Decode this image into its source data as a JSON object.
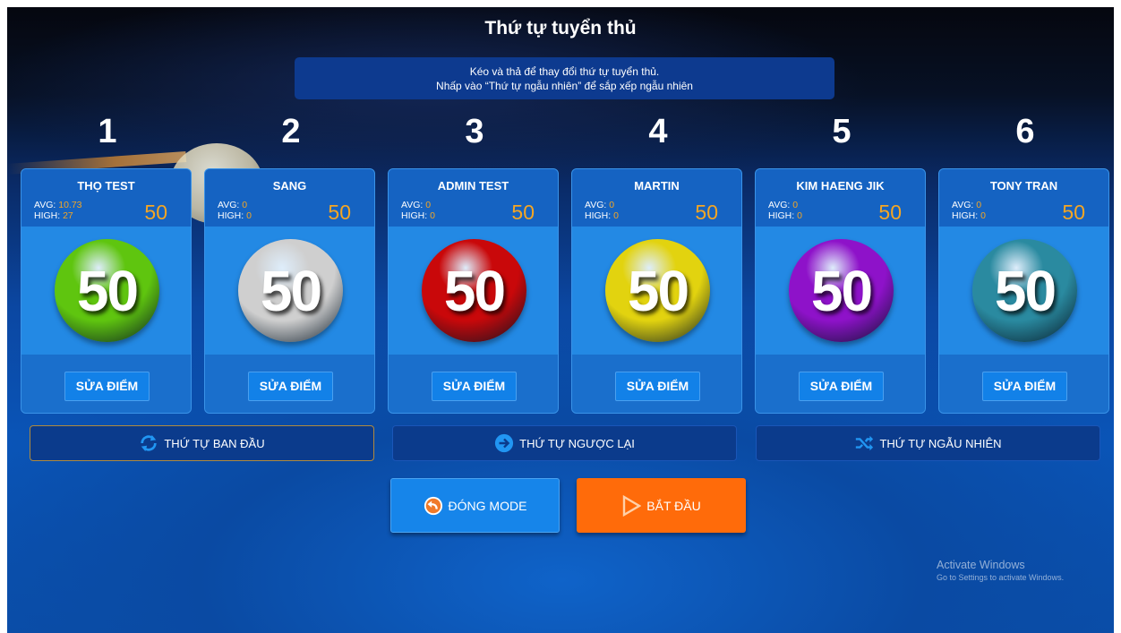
{
  "title": "Thứ tự tuyển thủ",
  "info": {
    "line1": "Kéo và thả để thay đổi thứ tự tuyển thủ.",
    "line2": "Nhấp vào “Thứ tự ngẫu nhiên” để sắp xếp ngẫu nhiên"
  },
  "players": [
    {
      "position": "1",
      "name": "THỌ TEST",
      "avg_label": "AVG:",
      "avg": "10.73",
      "high_label": "HIGH:",
      "high": "27",
      "score": "50",
      "ball_number": "50",
      "ball_color": "#5fc50f",
      "edit_label": "SỬA ĐIỂM"
    },
    {
      "position": "2",
      "name": "SANG",
      "avg_label": "AVG:",
      "avg": "0",
      "high_label": "HIGH:",
      "high": "0",
      "score": "50",
      "ball_number": "50",
      "ball_color": "#cfcfcf",
      "edit_label": "SỬA ĐIỂM"
    },
    {
      "position": "3",
      "name": "ADMIN TEST",
      "avg_label": "AVG:",
      "avg": "0",
      "high_label": "HIGH:",
      "high": "0",
      "score": "50",
      "ball_number": "50",
      "ball_color": "#c9080a",
      "edit_label": "SỬA ĐIỂM"
    },
    {
      "position": "4",
      "name": "MARTIN",
      "avg_label": "AVG:",
      "avg": "0",
      "high_label": "HIGH:",
      "high": "0",
      "score": "50",
      "ball_number": "50",
      "ball_color": "#e2d30f",
      "edit_label": "SỬA ĐIỂM"
    },
    {
      "position": "5",
      "name": "KIM HAENG JIK",
      "avg_label": "AVG:",
      "avg": "0",
      "high_label": "HIGH:",
      "high": "0",
      "score": "50",
      "ball_number": "50",
      "ball_color": "#8e12c9",
      "edit_label": "SỬA ĐIỂM"
    },
    {
      "position": "6",
      "name": "TONY TRAN",
      "avg_label": "AVG:",
      "avg": "0",
      "high_label": "HIGH:",
      "high": "0",
      "score": "50",
      "ball_number": "50",
      "ball_color": "#2a8aa0",
      "edit_label": "SỬA ĐIỂM"
    }
  ],
  "order_buttons": {
    "original": {
      "label": "THỨ TỰ BAN ĐẦU",
      "icon": "refresh-icon",
      "icon_color": "#2196f3"
    },
    "reverse": {
      "label": "THỨ TỰ NGƯỢC LẠI",
      "icon": "arrow-right-circle-icon",
      "icon_color": "#2196f3"
    },
    "random": {
      "label": "THỨ TỰ NGẪU NHIÊN",
      "icon": "shuffle-icon",
      "icon_color": "#2196f3"
    }
  },
  "actions": {
    "close_label": "ĐÓNG MODE",
    "close_icon": "back-arrow-circle-icon",
    "start_label": "BẮT ĐẦU",
    "start_icon": "play-outline-icon"
  },
  "watermark": {
    "line1": "Activate Windows",
    "line2": "Go to Settings to activate Windows."
  }
}
